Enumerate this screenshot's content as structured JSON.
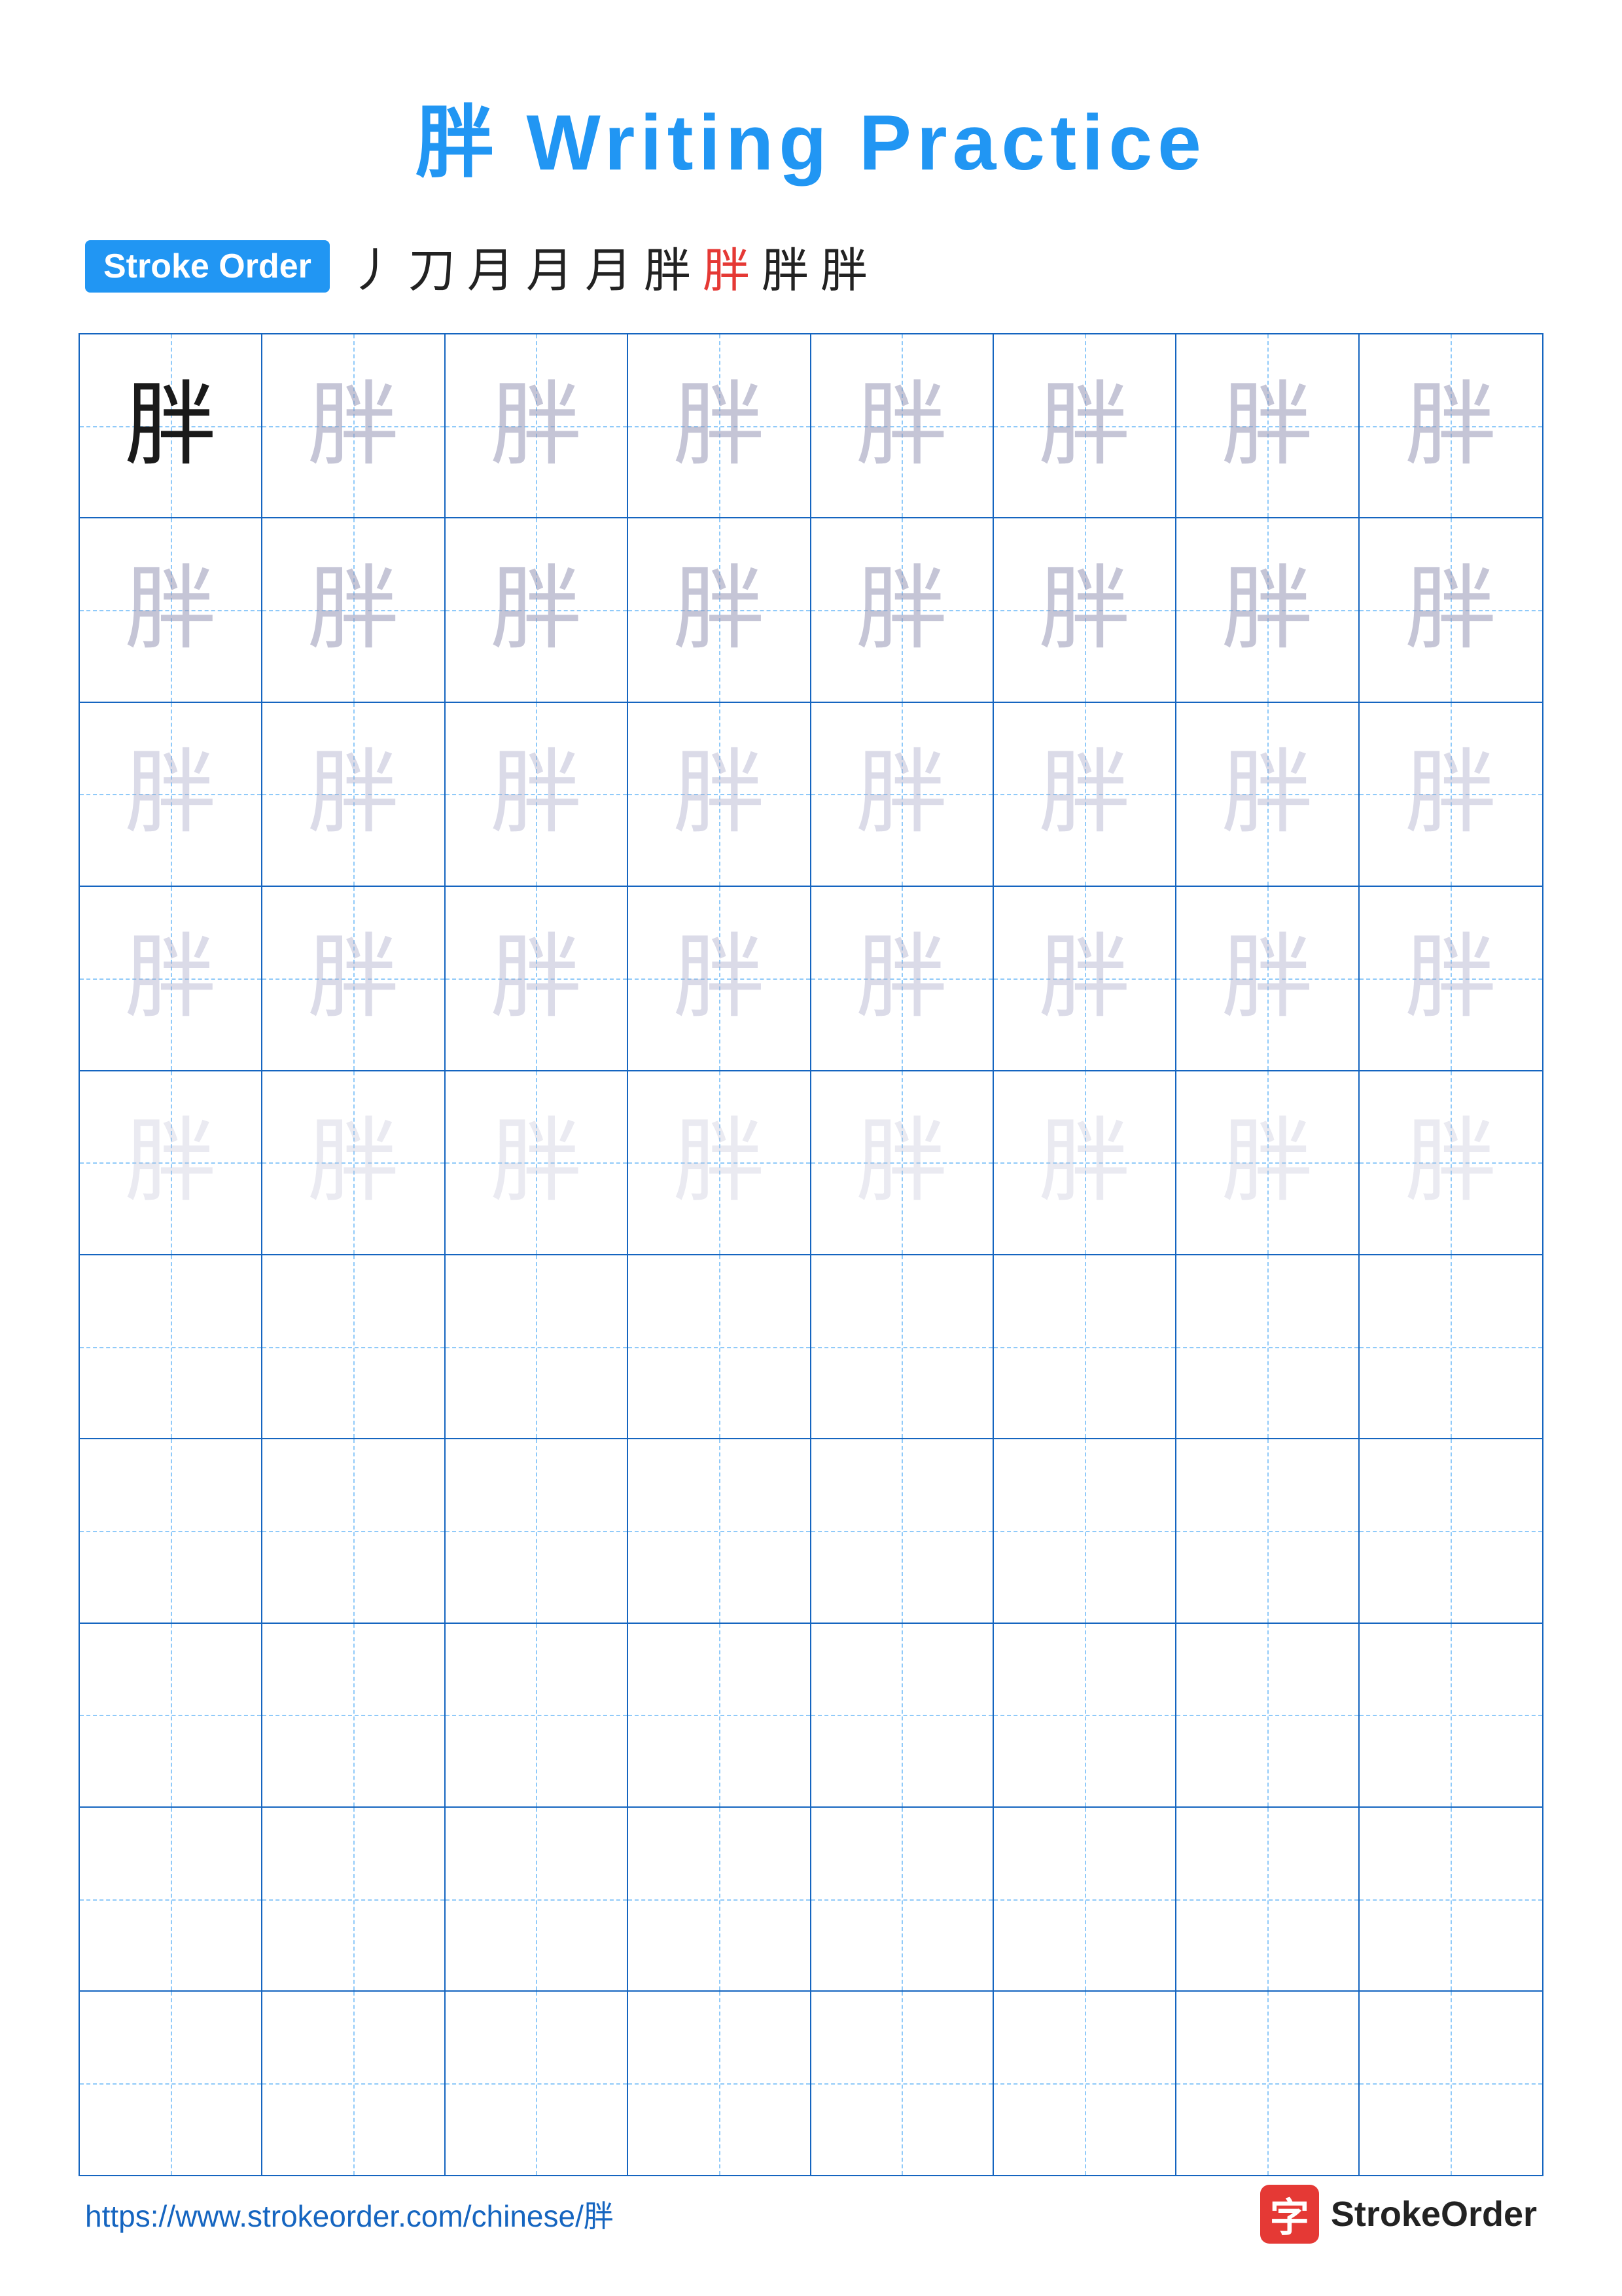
{
  "title": "胖 Writing Practice",
  "stroke_order": {
    "badge": "Stroke Order",
    "strokes": [
      "丿",
      "刀",
      "月",
      "月",
      "月'",
      "月⁻",
      "胖",
      "胖",
      "胖"
    ]
  },
  "character": "胖",
  "grid": {
    "rows": 10,
    "cols": 8
  },
  "footer": {
    "url": "https://www.strokeorder.com/chinese/胖",
    "logo_char": "字",
    "logo_name": "StrokeOrder"
  }
}
